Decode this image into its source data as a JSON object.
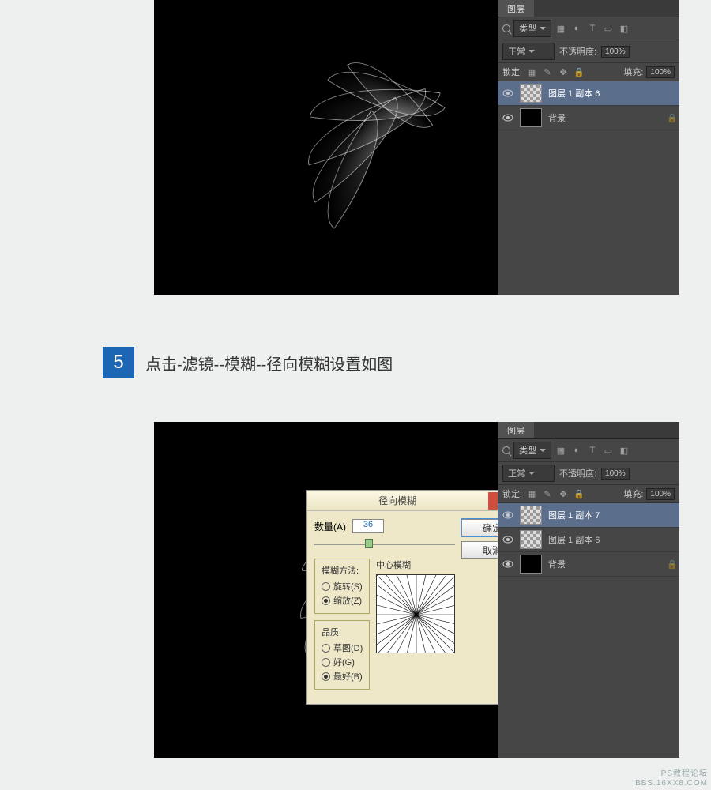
{
  "step": {
    "number": "5",
    "text": "点击-滤镜--模糊--径向模糊设置如图"
  },
  "panel": {
    "tab": "图层",
    "filter_label": "类型",
    "blend_mode": "正常",
    "opacity_label": "不透明度:",
    "opacity_value": "100%",
    "lock_label": "锁定:",
    "fill_label": "填充:",
    "fill_value": "100%"
  },
  "layers1": [
    {
      "name": "图层 1 副本 6",
      "selected": true,
      "thumb": "checker"
    },
    {
      "name": "背景",
      "selected": false,
      "thumb": "black",
      "locked": true
    }
  ],
  "layers2": [
    {
      "name": "图层 1 副本 7",
      "selected": true,
      "thumb": "checker"
    },
    {
      "name": "图层 1 副本 6",
      "selected": false,
      "thumb": "checker"
    },
    {
      "name": "背景",
      "selected": false,
      "thumb": "black",
      "locked": true
    }
  ],
  "dialog": {
    "title": "径向模糊",
    "ok": "确定",
    "cancel": "取消",
    "amount_label": "数量(A)",
    "amount_value": "36",
    "method_title": "模糊方法:",
    "method_spin": "旋转(S)",
    "method_zoom": "缩放(Z)",
    "quality_title": "品质:",
    "quality_draft": "草图(D)",
    "quality_good": "好(G)",
    "quality_best": "最好(B)",
    "center_label": "中心模糊"
  },
  "watermark": {
    "l1": "PS教程论坛",
    "l2": "BBS.16XX8.COM"
  }
}
